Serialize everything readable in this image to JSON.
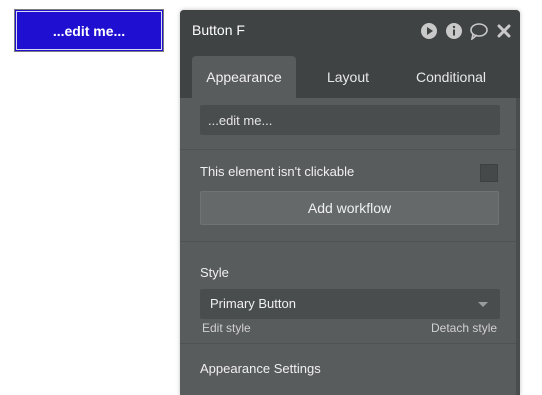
{
  "canvas": {
    "button_label": "...edit me..."
  },
  "panel": {
    "title": "Button F",
    "icons": [
      "play-icon",
      "info-icon",
      "comment-icon",
      "close-icon"
    ],
    "tabs": [
      {
        "label": "Appearance",
        "active": true
      },
      {
        "label": "Layout",
        "active": false
      },
      {
        "label": "Conditional",
        "active": false
      }
    ],
    "text_field_value": "...edit me...",
    "not_clickable_label": "This element isn't clickable",
    "add_workflow_label": "Add workflow",
    "style_label": "Style",
    "style_value": "Primary Button",
    "edit_style_label": "Edit style",
    "detach_style_label": "Detach style",
    "appearance_settings_label": "Appearance Settings"
  },
  "colors": {
    "button_blue": "#1f0fd1",
    "panel_bg": "#595c5d",
    "header_bg": "#3f4344"
  }
}
